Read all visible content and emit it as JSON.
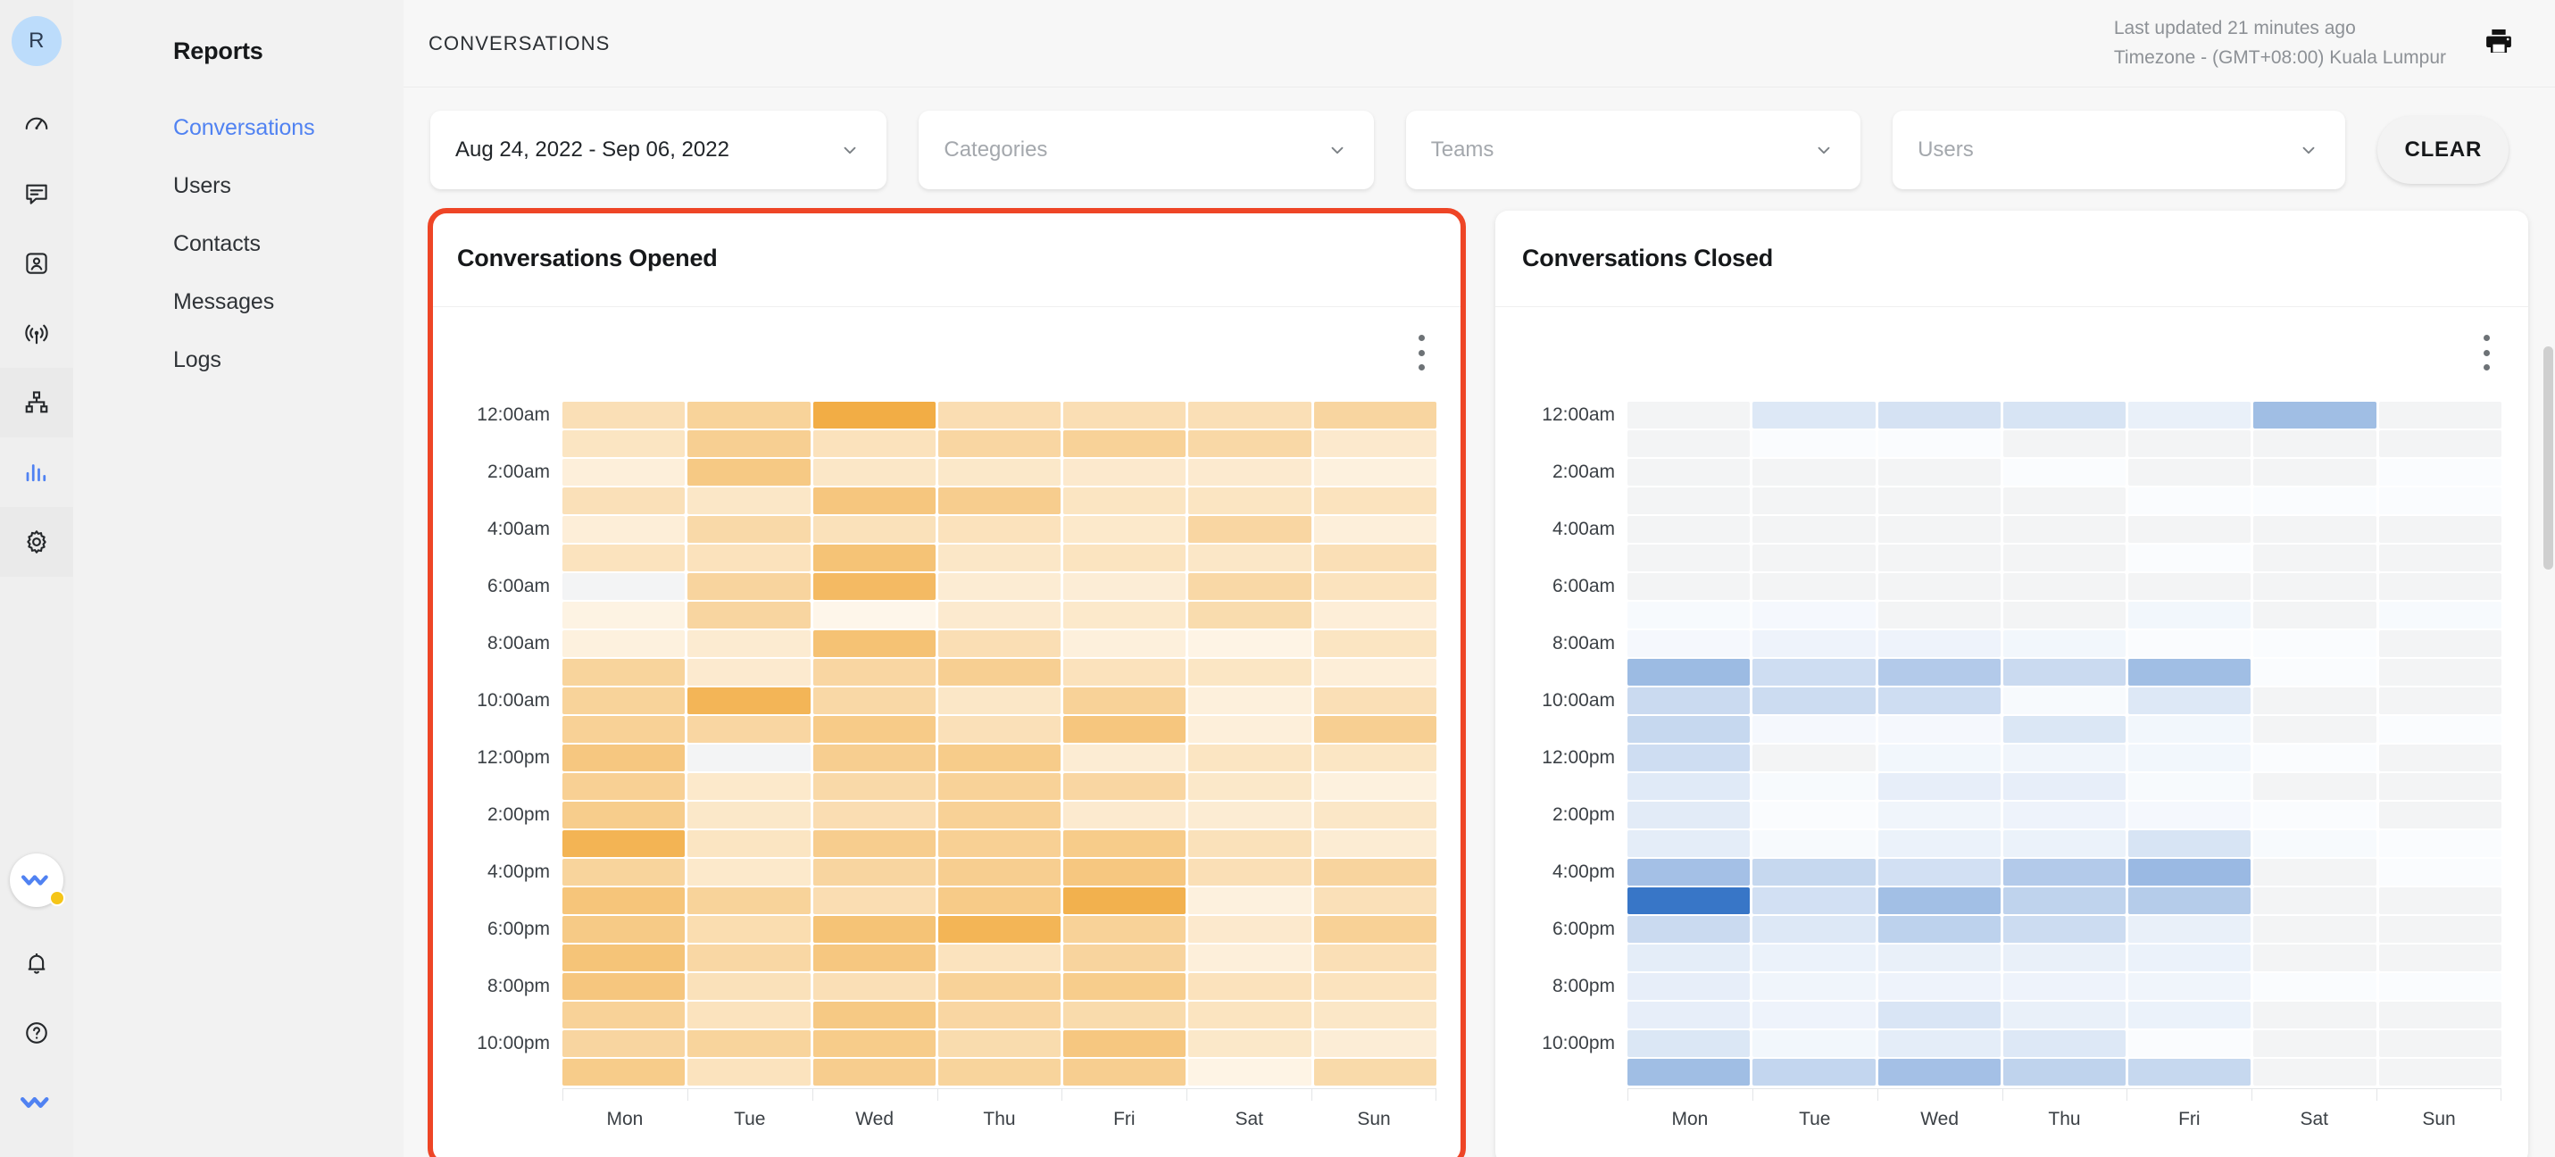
{
  "rail": {
    "avatar_initial": "R",
    "icons": [
      {
        "name": "speedometer-icon"
      },
      {
        "name": "chat-bubble-icon"
      },
      {
        "name": "contact-card-icon"
      },
      {
        "name": "broadcast-icon"
      },
      {
        "name": "org-chart-icon"
      },
      {
        "name": "bar-chart-icon"
      },
      {
        "name": "gear-icon"
      }
    ],
    "bottom_icons": [
      {
        "name": "app-logo-badge-icon"
      },
      {
        "name": "bell-icon"
      },
      {
        "name": "help-circle-icon"
      },
      {
        "name": "double-check-logo-icon"
      }
    ]
  },
  "sidebar": {
    "title": "Reports",
    "items": [
      {
        "label": "Conversations",
        "active": true
      },
      {
        "label": "Users",
        "active": false
      },
      {
        "label": "Contacts",
        "active": false
      },
      {
        "label": "Messages",
        "active": false
      },
      {
        "label": "Logs",
        "active": false
      }
    ]
  },
  "header": {
    "title": "CONVERSATIONS",
    "last_updated": "Last updated 21 minutes ago",
    "timezone": "Timezone - (GMT+08:00) Kuala Lumpur",
    "print_icon": "printer-icon"
  },
  "filters": {
    "date_range": {
      "value": "Aug 24, 2022 - Sep 06, 2022",
      "placeholder": ""
    },
    "categories": {
      "value": "",
      "placeholder": "Categories"
    },
    "teams": {
      "value": "",
      "placeholder": "Teams"
    },
    "users": {
      "value": "",
      "placeholder": "Users"
    },
    "clear_label": "CLEAR"
  },
  "colors": {
    "accent_blue": "#5082f2",
    "highlight_border": "#ee4526",
    "opened_max": "#f0a32e",
    "closed_max": "#2f6fc4",
    "empty_cell": "#f3f4f5"
  },
  "chart_data": [
    {
      "type": "heatmap",
      "title": "Conversations Opened",
      "menu_icon": "kebab-menu-icon",
      "xlabel": "",
      "ylabel": "",
      "categories": [
        "Mon",
        "Tue",
        "Wed",
        "Thu",
        "Fri",
        "Sat",
        "Sun"
      ],
      "ytick_labels": [
        "12:00am",
        "2:00am",
        "4:00am",
        "6:00am",
        "8:00am",
        "10:00am",
        "12:00pm",
        "2:00pm",
        "4:00pm",
        "6:00pm",
        "8:00pm",
        "10:00pm"
      ],
      "rows": [
        "12am",
        "1am",
        "2am",
        "3am",
        "4am",
        "5am",
        "6am",
        "7am",
        "8am",
        "9am",
        "10am",
        "11am",
        "12pm",
        "1pm",
        "2pm",
        "3pm",
        "4pm",
        "5pm",
        "6pm",
        "7pm",
        "8pm",
        "9pm",
        "10pm",
        "11pm"
      ],
      "color_scale": [
        "#fffdf9",
        "#f0a32e"
      ],
      "vmin": 0,
      "vmax": 100,
      "values": [
        [
          30,
          44,
          88,
          32,
          31,
          30,
          41
        ],
        [
          24,
          48,
          27,
          40,
          45,
          38,
          19
        ],
        [
          13,
          55,
          22,
          21,
          19,
          18,
          11
        ],
        [
          29,
          22,
          58,
          50,
          24,
          24,
          26
        ],
        [
          14,
          37,
          28,
          27,
          20,
          40,
          13
        ],
        [
          26,
          27,
          62,
          22,
          25,
          22,
          30
        ],
        [
          0,
          42,
          72,
          16,
          15,
          38,
          26
        ],
        [
          9,
          41,
          6,
          18,
          20,
          34,
          14
        ],
        [
          11,
          17,
          63,
          31,
          12,
          8,
          24
        ],
        [
          43,
          18,
          40,
          48,
          27,
          23,
          14
        ],
        [
          44,
          78,
          38,
          22,
          45,
          12,
          30
        ],
        [
          46,
          40,
          53,
          29,
          58,
          13,
          48
        ],
        [
          57,
          0,
          49,
          52,
          16,
          24,
          23
        ],
        [
          47,
          20,
          37,
          45,
          40,
          21,
          11
        ],
        [
          51,
          21,
          32,
          46,
          18,
          16,
          22
        ],
        [
          80,
          24,
          50,
          47,
          52,
          28,
          16
        ],
        [
          43,
          20,
          41,
          49,
          57,
          30,
          42
        ],
        [
          60,
          44,
          32,
          53,
          83,
          11,
          29
        ],
        [
          54,
          33,
          62,
          79,
          45,
          19,
          46
        ],
        [
          61,
          39,
          57,
          26,
          42,
          13,
          30
        ],
        [
          58,
          28,
          30,
          45,
          51,
          27,
          26
        ],
        [
          45,
          26,
          55,
          40,
          35,
          25,
          22
        ],
        [
          41,
          43,
          52,
          34,
          57,
          21,
          15
        ],
        [
          52,
          26,
          50,
          43,
          49,
          8,
          36
        ]
      ]
    },
    {
      "type": "heatmap",
      "title": "Conversations Closed",
      "menu_icon": "kebab-menu-icon",
      "xlabel": "",
      "ylabel": "",
      "categories": [
        "Mon",
        "Tue",
        "Wed",
        "Thu",
        "Fri",
        "Sat",
        "Sun"
      ],
      "ytick_labels": [
        "12:00am",
        "2:00am",
        "4:00am",
        "6:00am",
        "8:00am",
        "10:00am",
        "12:00pm",
        "2:00pm",
        "4:00pm",
        "6:00pm",
        "8:00pm",
        "10:00pm"
      ],
      "rows": [
        "12am",
        "1am",
        "2am",
        "3am",
        "4am",
        "5am",
        "6am",
        "7am",
        "8am",
        "9am",
        "10am",
        "11am",
        "12pm",
        "1pm",
        "2pm",
        "3pm",
        "4pm",
        "5pm",
        "6pm",
        "7pm",
        "8pm",
        "9pm",
        "10pm",
        "11pm"
      ],
      "color_scale": [
        "#fdfeff",
        "#2f6fc4"
      ],
      "vmin": 0,
      "vmax": 100,
      "values": [
        [
          0,
          13,
          17,
          16,
          8,
          42,
          0
        ],
        [
          0,
          1,
          1,
          0,
          0,
          0,
          0
        ],
        [
          0,
          0,
          0,
          1,
          0,
          0,
          1
        ],
        [
          0,
          0,
          0,
          0,
          1,
          1,
          1
        ],
        [
          0,
          0,
          0,
          0,
          0,
          0,
          0
        ],
        [
          0,
          0,
          0,
          0,
          1,
          0,
          0
        ],
        [
          0,
          0,
          0,
          0,
          0,
          0,
          0
        ],
        [
          2,
          3,
          0,
          0,
          4,
          0,
          2
        ],
        [
          3,
          6,
          6,
          4,
          1,
          1,
          0
        ],
        [
          44,
          20,
          33,
          22,
          42,
          1,
          0
        ],
        [
          22,
          21,
          20,
          2,
          13,
          0,
          0
        ],
        [
          24,
          3,
          3,
          14,
          4,
          0,
          1
        ],
        [
          20,
          0,
          4,
          5,
          4,
          1,
          0
        ],
        [
          12,
          2,
          9,
          9,
          2,
          0,
          0
        ],
        [
          11,
          1,
          5,
          6,
          3,
          1,
          0
        ],
        [
          10,
          2,
          7,
          7,
          16,
          2,
          1
        ],
        [
          40,
          24,
          18,
          33,
          45,
          0,
          1
        ],
        [
          95,
          18,
          41,
          27,
          32,
          0,
          0
        ],
        [
          22,
          13,
          28,
          21,
          8,
          0,
          0
        ],
        [
          10,
          7,
          8,
          8,
          7,
          0,
          0
        ],
        [
          9,
          5,
          6,
          6,
          5,
          1,
          1
        ],
        [
          9,
          6,
          15,
          8,
          7,
          0,
          0
        ],
        [
          14,
          4,
          10,
          13,
          1,
          0,
          0
        ],
        [
          42,
          25,
          40,
          27,
          24,
          0,
          0
        ]
      ]
    }
  ],
  "scrollbar": {
    "name": "vertical-scrollbar"
  }
}
